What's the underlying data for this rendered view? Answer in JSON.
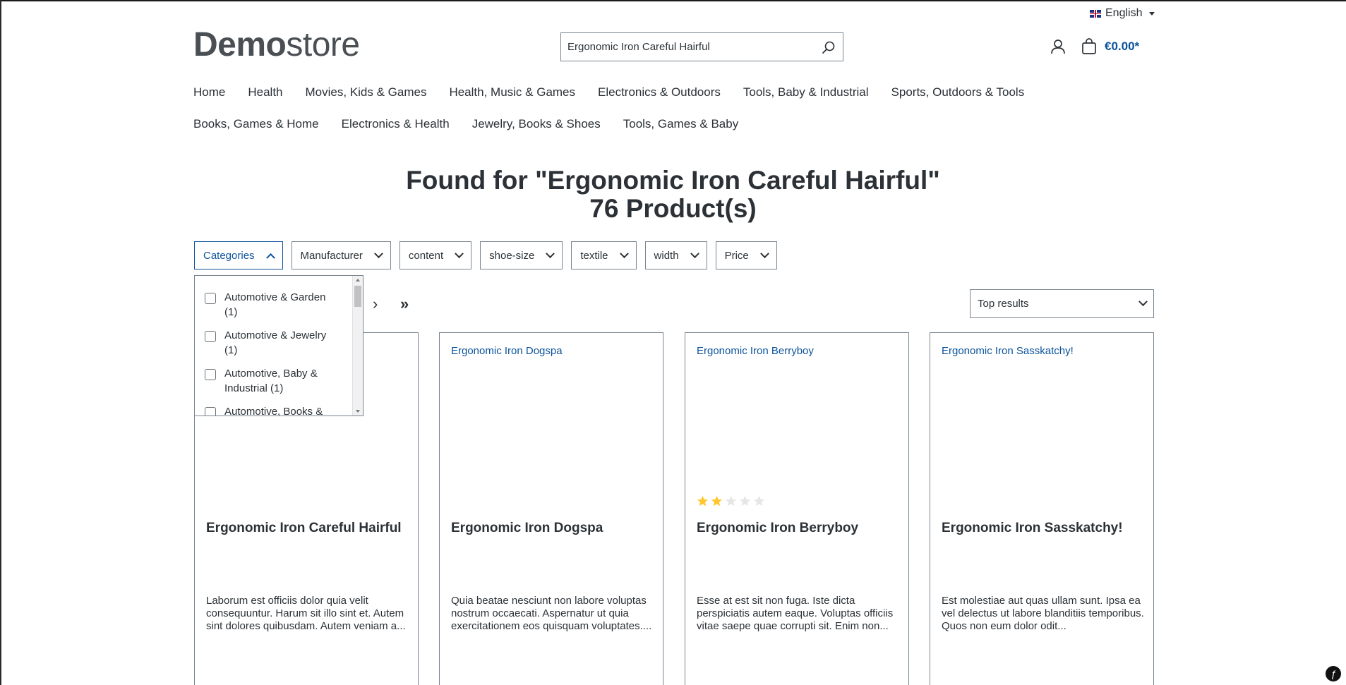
{
  "topbar": {
    "language": "English"
  },
  "header": {
    "logo_bold": "Demo",
    "logo_light": "store",
    "search_value": "Ergonomic Iron Careful Hairful",
    "cart_total": "€0.00*"
  },
  "nav": {
    "row1": [
      "Home",
      "Health",
      "Movies, Kids & Games",
      "Health, Music & Games",
      "Electronics & Outdoors",
      "Tools, Baby & Industrial",
      "Sports, Outdoors & Tools"
    ],
    "row2": [
      "Books, Games & Home",
      "Electronics & Health",
      "Jewelry, Books & Shoes",
      "Tools, Games & Baby"
    ]
  },
  "heading": {
    "line1": "Found for \"Ergonomic Iron Careful Hairful\"",
    "line2": "76 Product(s)"
  },
  "filters": [
    "Categories",
    "Manufacturer",
    "content",
    "shoe-size",
    "textile",
    "width",
    "Price"
  ],
  "categories_dropdown": [
    "Automotive & Garden (1)",
    "Automotive & Jewelry (1)",
    "Automotive, Baby & Industrial (1)",
    "Automotive, Books &"
  ],
  "pagination": {
    "next": "›",
    "last": "»"
  },
  "sort": {
    "selected": "Top results"
  },
  "products": [
    {
      "image_alt": "",
      "name": "Ergonomic Iron Careful Hairful",
      "rating": 0,
      "description": "Laborum est officiis dolor quia velit consequuntur. Harum sit illo sint et. Autem sint dolores quibusdam. Autem veniam a..."
    },
    {
      "image_alt": "Ergonomic Iron Dogspa",
      "name": "Ergonomic Iron Dogspa",
      "rating": 0,
      "description": "Quia beatae nesciunt non labore voluptas nostrum occaecati. Aspernatur ut quia exercitationem eos quisquam voluptates...."
    },
    {
      "image_alt": "Ergonomic Iron Berryboy",
      "name": "Ergonomic Iron Berryboy",
      "rating": 2,
      "description": "Esse at est sit non fuga. Iste dicta perspiciatis autem eaque. Voluptas officiis vitae saepe quae corrupti sit. Enim non..."
    },
    {
      "image_alt": "Ergonomic Iron Sasskatchy!",
      "name": "Ergonomic Iron Sasskatchy!",
      "rating": 0,
      "description": "Est molestiae aut quas ullam sunt. Ipsa ea vel delectus ut labore blanditiis temporibus. Quos non eum dolor odit..."
    }
  ],
  "colors": {
    "accent": "#0b539b",
    "star": "#ffc72c",
    "star_empty": "#e6e6e6"
  }
}
